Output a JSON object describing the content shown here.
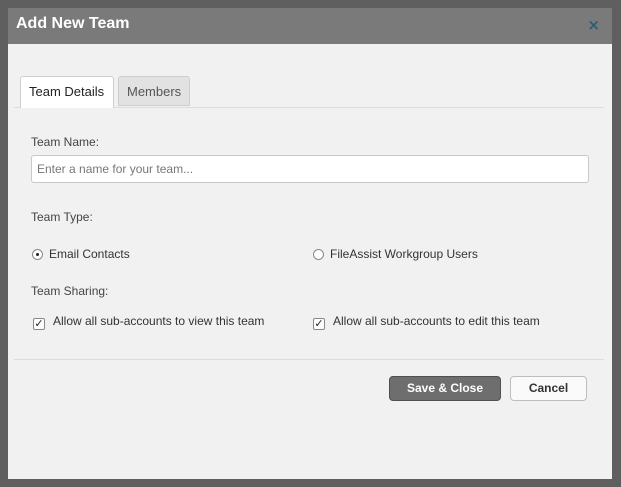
{
  "dialog": {
    "title": "Add New Team",
    "close_glyph": "×",
    "tabs": [
      {
        "label": "Team Details",
        "active": true
      },
      {
        "label": "Members",
        "active": false
      }
    ]
  },
  "form": {
    "team_name": {
      "label": "Team Name:",
      "placeholder": "Enter a name for your team...",
      "value": ""
    },
    "team_type": {
      "label": "Team Type:",
      "options": [
        {
          "label": "Email Contacts",
          "selected": true
        },
        {
          "label": "FileAssist Workgroup Users",
          "selected": false
        }
      ]
    },
    "team_sharing": {
      "label": "Team Sharing:",
      "options": [
        {
          "label": "Allow all sub-accounts to view this team",
          "checked": true
        },
        {
          "label": "Allow all sub-accounts to edit this team",
          "checked": true
        }
      ]
    }
  },
  "buttons": {
    "save_label": "Save & Close",
    "cancel_label": "Cancel"
  },
  "glyphs": {
    "check": "✓"
  },
  "colors": {
    "titlebar": "#7a7a7a",
    "close_icon": "#2e5a7a",
    "save_button": "#6e6e6e"
  }
}
